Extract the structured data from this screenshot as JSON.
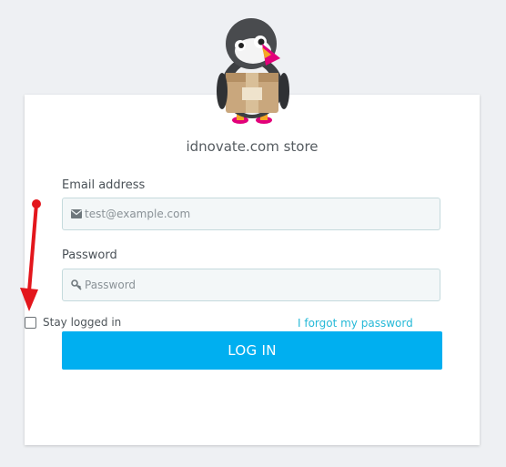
{
  "store": {
    "name": "idnovate.com store"
  },
  "login_form": {
    "email_label": "Email address",
    "email_placeholder": "test@example.com",
    "password_label": "Password",
    "password_placeholder": "Password",
    "stay_logged_in_label": "Stay logged in",
    "forgot_password_label": "I forgot my password",
    "submit_label": "LOG IN"
  },
  "colors": {
    "accent": "#00aff0",
    "link": "#25b9d7",
    "annotation_arrow": "#e3161c"
  },
  "icons": {
    "logo": "puffin-mascot-icon",
    "email": "envelope-icon",
    "password": "key-icon",
    "annotation": "red-arrow-icon"
  }
}
